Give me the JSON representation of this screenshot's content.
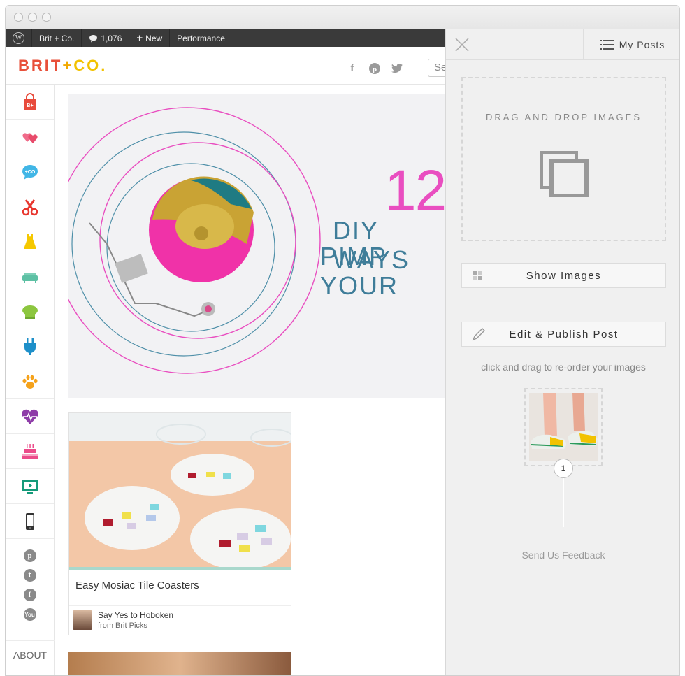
{
  "adminbar": {
    "wp_logo": "W",
    "site_name": "Brit + Co.",
    "comments_count": "1,076",
    "new_label": "New",
    "performance_label": "Performance"
  },
  "header": {
    "logo_left": "BRIT",
    "logo_plus": "+",
    "logo_right": "CO.",
    "search_placeholder": "Se"
  },
  "hero": {
    "number": "12",
    "line1": "DIY WAYS",
    "line2": "PIMP YOUR"
  },
  "card": {
    "title": "Easy Mosiac Tile Coasters",
    "author": "Say Yes to Hoboken",
    "source": "from Brit Picks"
  },
  "sidebar": {
    "about": "ABOUT",
    "bag_label": "B+",
    "chat_label": "+CO"
  },
  "panel": {
    "my_posts": "My Posts",
    "drop_text": "DRAG AND DROP IMAGES",
    "show_images": "Show Images",
    "edit_publish": "Edit & Publish Post",
    "hint": "click and drag to re-order your images",
    "thumb_index": "1",
    "feedback": "Send Us Feedback"
  },
  "colors": {
    "brand_red": "#e8503a",
    "brand_yellow": "#f2c200",
    "hero_pink": "#e94ec0",
    "hero_blue": "#4e8fa8"
  }
}
